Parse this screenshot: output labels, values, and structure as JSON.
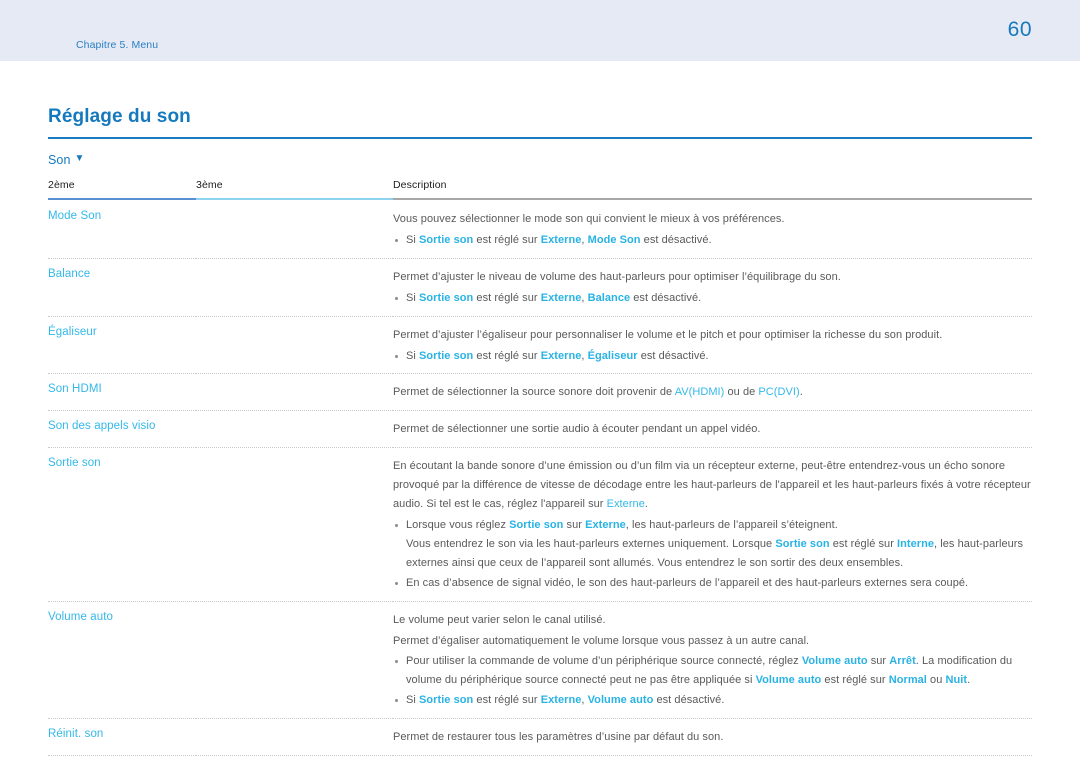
{
  "header": {
    "chapter": "Chapitre 5. Menu",
    "page_number": "60",
    "background_color": "#e6eaf5",
    "text_color": "#2a7fc4"
  },
  "section": {
    "title": "Réglage du son",
    "title_color": "#1679bd",
    "menu_root": "Son",
    "menu_caret_icon": "▼"
  },
  "table": {
    "columns": [
      "2ème",
      "3ème",
      "Description"
    ],
    "header_rule_colors": [
      "#5b8fd4",
      "#8fd4ef",
      "#a8a8a8"
    ],
    "rows": [
      {
        "second_level": "Mode Son",
        "third_level": "",
        "paragraphs": [
          "Vous pouvez sélectionner le mode son qui convient le mieux à vos préférences."
        ],
        "bullets": [
          {
            "parts": [
              {
                "t": "Si ",
                "s": "plain"
              },
              {
                "t": "Sortie son",
                "s": "kw-b"
              },
              {
                "t": " est réglé sur ",
                "s": "plain"
              },
              {
                "t": "Externe",
                "s": "kw-b"
              },
              {
                "t": ", ",
                "s": "plain"
              },
              {
                "t": "Mode Son",
                "s": "kw-b"
              },
              {
                "t": " est désactivé.",
                "s": "plain"
              }
            ]
          }
        ]
      },
      {
        "second_level": "Balance",
        "third_level": "",
        "paragraphs": [
          "Permet d’ajuster le niveau de volume des haut-parleurs pour optimiser l’équilibrage du son."
        ],
        "bullets": [
          {
            "parts": [
              {
                "t": "Si ",
                "s": "plain"
              },
              {
                "t": "Sortie son",
                "s": "kw-b"
              },
              {
                "t": " est réglé sur ",
                "s": "plain"
              },
              {
                "t": "Externe",
                "s": "kw-b"
              },
              {
                "t": ", ",
                "s": "plain"
              },
              {
                "t": "Balance",
                "s": "kw-b"
              },
              {
                "t": " est désactivé.",
                "s": "plain"
              }
            ]
          }
        ]
      },
      {
        "second_level": "Égaliseur",
        "third_level": "",
        "paragraphs": [
          "Permet d’ajuster l’égaliseur pour personnaliser le volume et le pitch et pour optimiser la richesse du son produit."
        ],
        "bullets": [
          {
            "parts": [
              {
                "t": "Si ",
                "s": "plain"
              },
              {
                "t": "Sortie son",
                "s": "kw-b"
              },
              {
                "t": " est réglé sur ",
                "s": "plain"
              },
              {
                "t": "Externe",
                "s": "kw-b"
              },
              {
                "t": ", ",
                "s": "plain"
              },
              {
                "t": "Égaliseur",
                "s": "kw-b"
              },
              {
                "t": " est désactivé.",
                "s": "plain"
              }
            ]
          }
        ]
      },
      {
        "second_level": "Son HDMI",
        "third_level": "",
        "paragraph_parts": [
          [
            {
              "t": "Permet de sélectionner la source sonore doit provenir de ",
              "s": "plain"
            },
            {
              "t": "AV(HDMI)",
              "s": "kw"
            },
            {
              "t": " ou de ",
              "s": "plain"
            },
            {
              "t": "PC(DVI)",
              "s": "kw"
            },
            {
              "t": ".",
              "s": "plain"
            }
          ]
        ],
        "bullets": []
      },
      {
        "second_level": "Son des appels visio",
        "third_level": "",
        "paragraphs": [
          "Permet de sélectionner une sortie audio à écouter pendant un appel vidéo."
        ],
        "bullets": []
      },
      {
        "second_level": "Sortie son",
        "third_level": "",
        "paragraph_parts": [
          [
            {
              "t": "En écoutant la bande sonore d’une émission ou d’un film via un récepteur externe, peut-être entendrez-vous un écho sonore provoqué par la différence de vitesse de décodage entre les haut-parleurs de l'appareil et les haut-parleurs fixés à votre récepteur audio. Si tel est le cas, réglez l'appareil sur ",
              "s": "plain"
            },
            {
              "t": "Externe",
              "s": "kw"
            },
            {
              "t": ".",
              "s": "plain"
            }
          ]
        ],
        "bullets": [
          {
            "parts": [
              {
                "t": "Lorsque vous réglez ",
                "s": "plain"
              },
              {
                "t": "Sortie son",
                "s": "kw-b"
              },
              {
                "t": " sur ",
                "s": "plain"
              },
              {
                "t": "Externe",
                "s": "kw-b"
              },
              {
                "t": ", les haut-parleurs de l’appareil s’éteignent.",
                "s": "plain"
              },
              {
                "t": "BR",
                "s": "br"
              },
              {
                "t": "Vous entendrez le son via les haut-parleurs externes uniquement. Lorsque ",
                "s": "plain"
              },
              {
                "t": "Sortie son",
                "s": "kw-b"
              },
              {
                "t": " est réglé sur ",
                "s": "plain"
              },
              {
                "t": "Interne",
                "s": "kw-b"
              },
              {
                "t": ", les haut-parleurs externes ainsi que ceux de l’appareil sont allumés. Vous entendrez le son sortir des deux ensembles.",
                "s": "plain"
              }
            ]
          },
          {
            "parts": [
              {
                "t": "En cas d’absence de signal vidéo, le son des haut-parleurs de l’appareil et des haut-parleurs externes sera coupé.",
                "s": "plain"
              }
            ]
          }
        ]
      },
      {
        "second_level": "Volume auto",
        "third_level": "",
        "paragraphs": [
          "Le volume peut varier selon le canal utilisé.",
          "Permet d’égaliser automatiquement le volume lorsque vous passez à un autre canal."
        ],
        "bullets": [
          {
            "parts": [
              {
                "t": "Pour utiliser la commande de volume d’un périphérique source connecté, réglez ",
                "s": "plain"
              },
              {
                "t": "Volume auto",
                "s": "kw-b"
              },
              {
                "t": " sur ",
                "s": "plain"
              },
              {
                "t": "Arrêt",
                "s": "kw-b"
              },
              {
                "t": ". La modification du volume du périphérique source connecté peut ne pas être appliquée si ",
                "s": "plain"
              },
              {
                "t": "Volume auto",
                "s": "kw-b"
              },
              {
                "t": " est réglé sur ",
                "s": "plain"
              },
              {
                "t": "Normal",
                "s": "kw-b"
              },
              {
                "t": " ou ",
                "s": "plain"
              },
              {
                "t": "Nuit",
                "s": "kw-b"
              },
              {
                "t": ".",
                "s": "plain"
              }
            ]
          },
          {
            "parts": [
              {
                "t": "Si ",
                "s": "plain"
              },
              {
                "t": "Sortie son",
                "s": "kw-b"
              },
              {
                "t": " est réglé sur ",
                "s": "plain"
              },
              {
                "t": "Externe",
                "s": "kw-b"
              },
              {
                "t": ", ",
                "s": "plain"
              },
              {
                "t": "Volume auto",
                "s": "kw-b"
              },
              {
                "t": " est désactivé.",
                "s": "plain"
              }
            ]
          }
        ]
      },
      {
        "second_level": "Réinit. son",
        "third_level": "",
        "paragraphs": [
          "Permet de restaurer tous les paramètres d’usine par défaut du son."
        ],
        "bullets": []
      }
    ]
  }
}
